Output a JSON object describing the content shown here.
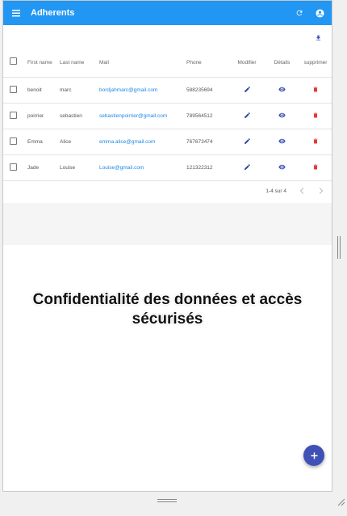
{
  "app": {
    "title": "Adherents"
  },
  "icons": {
    "menu": "menu-icon",
    "refresh": "refresh-icon",
    "account": "account-circle-icon",
    "download": "download-icon",
    "edit": "edit-icon",
    "view": "eye-icon",
    "delete": "delete-icon",
    "add": "plus-icon"
  },
  "colors": {
    "appbar": "#2196f3",
    "edit": "#303f9f",
    "view": "#3f51b5",
    "delete": "#e53935",
    "fab": "#3f51b5",
    "link": "#1e88e5"
  },
  "table": {
    "headers": {
      "first": "First name",
      "last": "Last name",
      "mail": "Mail",
      "phone": "Phone",
      "modify": "Modifier",
      "details": "Détails",
      "delete": "supprimer"
    },
    "rows": [
      {
        "first": "benoit",
        "last": "marc",
        "mail": "bordjahmarc@gmail.com",
        "phone": "588235694"
      },
      {
        "first": "poirrier",
        "last": "sebastien",
        "mail": "sebastienpoirrier@gmail.com",
        "phone": "789564512"
      },
      {
        "first": "Emma",
        "last": "Alice",
        "mail": "emma.alice@gmail.com",
        "phone": "767673474"
      },
      {
        "first": "Jade",
        "last": "Louise",
        "mail": "Louise@gmail.com",
        "phone": "121322312"
      }
    ]
  },
  "pager": {
    "range": "1-4 sur 4"
  },
  "caption": {
    "line1": "Confidentialité des données et accès",
    "line2": "sécurisés"
  }
}
